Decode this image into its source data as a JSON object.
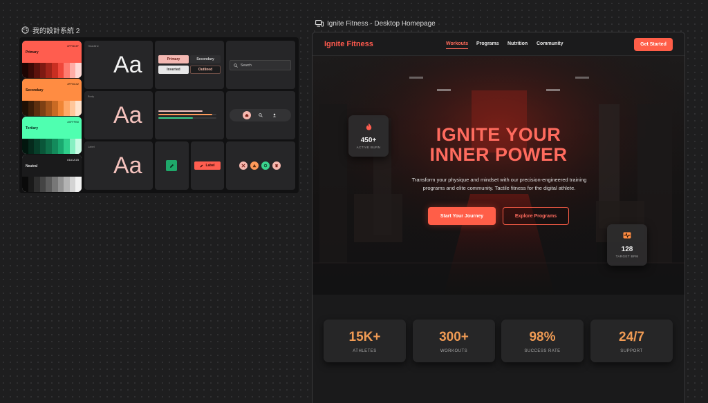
{
  "canvas": {
    "left_frame_label": "我的設計系統 2",
    "right_frame_label": "Ignite Fitness - Desktop Homepage"
  },
  "design_system": {
    "swatches": [
      {
        "name": "Primary",
        "hex": "#FF5D4F",
        "color": "#ff5d4f",
        "text_color": "#1a0a0a",
        "scale": [
          "#1d0503",
          "#3b0a06",
          "#5c120c",
          "#7e1a12",
          "#a22419",
          "#c92f22",
          "#f0473a",
          "#ff7b70",
          "#ffada6",
          "#ffd9d5"
        ]
      },
      {
        "name": "Secondary",
        "hex": "#FF8C42",
        "color": "#ff8c42",
        "text_color": "#1e0f04",
        "scale": [
          "#1e0f04",
          "#3b1d08",
          "#5c2e0e",
          "#7e4014",
          "#a3541b",
          "#c96a24",
          "#f08535",
          "#ffa867",
          "#ffc69a",
          "#ffe3cd"
        ]
      },
      {
        "name": "Tertiary",
        "hex": "#4FFFB0",
        "color": "#4fffb0",
        "text_color": "#05241a",
        "scale": [
          "#02160e",
          "#052a1c",
          "#073f2a",
          "#0a5639",
          "#0f6f49",
          "#138a5b",
          "#1aa86f",
          "#2fcf8c",
          "#86f0c2",
          "#c9fbe4"
        ]
      },
      {
        "name": "Neutral",
        "hex": "#1A1A1B",
        "color": "#1a1a1b",
        "text_color": "#e0e0e0",
        "scale": [
          "#0a0a0a",
          "#1a1a1a",
          "#2e2e2e",
          "#444444",
          "#5c5c5c",
          "#777777",
          "#939393",
          "#b3b3b3",
          "#d3d3d3",
          "#f1f1f1"
        ]
      }
    ],
    "type_samples": [
      {
        "label": "Headline",
        "sample": "Aa",
        "color": "#f2f2f2"
      },
      {
        "label": "Body",
        "sample": "Aa",
        "color": "#f4c2bd"
      },
      {
        "label": "Label",
        "sample": "Aa",
        "color": "#f4c2bd"
      }
    ],
    "buttons": {
      "primary": "Primary",
      "secondary": "Secondary",
      "inverted": "Inverted",
      "outlined": "Outlined",
      "label_button": "Label"
    },
    "search_placeholder": "Search"
  },
  "site": {
    "brand": "Ignite Fitness",
    "nav": [
      {
        "label": "Workouts",
        "active": true
      },
      {
        "label": "Programs",
        "active": false
      },
      {
        "label": "Nutrition",
        "active": false
      },
      {
        "label": "Community",
        "active": false
      }
    ],
    "cta": "Get Started",
    "hero": {
      "title_line1": "IGNITE YOUR",
      "title_line2": "INNER POWER",
      "subtitle_line1": "Transform your physique and mindset with our precision-engineered training",
      "subtitle_line2": "programs and elite community. Tactile fitness for the digital athlete.",
      "primary_button": "Start Your Journey",
      "secondary_button": "Explore Programs"
    },
    "floating_cards": [
      {
        "value": "450+",
        "caption": "ACTIVE BURN",
        "icon": "flame-icon"
      },
      {
        "value": "128",
        "caption": "TARGET BPM",
        "icon": "pulse-icon"
      }
    ],
    "stats": [
      {
        "value": "15K+",
        "label": "ATHLETES"
      },
      {
        "value": "300+",
        "label": "WORKOUTS"
      },
      {
        "value": "98%",
        "label": "SUCCESS RATE"
      },
      {
        "value": "24/7",
        "label": "SUPPORT"
      }
    ],
    "accent_color": "#ff5e48",
    "stat_color": "#f09b54"
  }
}
